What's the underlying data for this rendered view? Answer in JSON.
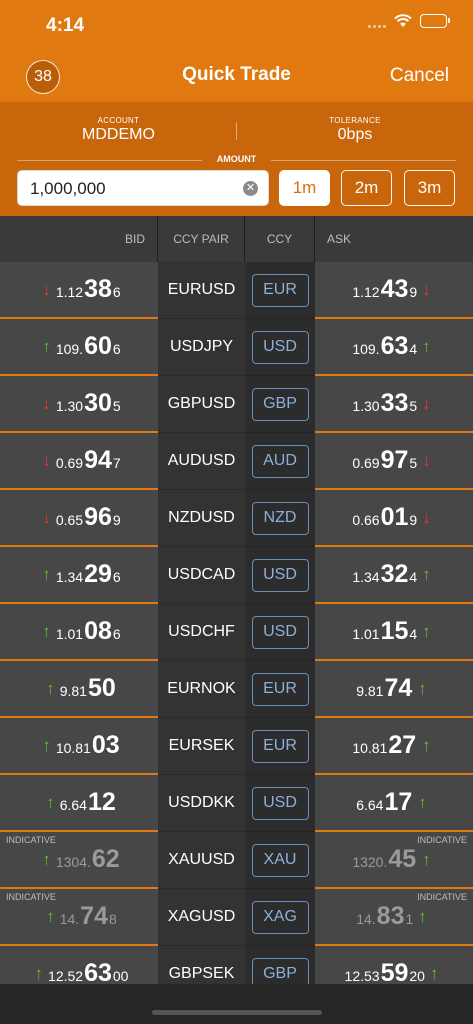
{
  "status": {
    "time": "4:14"
  },
  "nav": {
    "badge": "38",
    "title": "Quick Trade",
    "cancel": "Cancel"
  },
  "account": {
    "label": "ACCOUNT",
    "value": "MDDEMO"
  },
  "tolerance": {
    "label": "TOLERANCE",
    "value": "0bps"
  },
  "amount": {
    "label": "AMOUNT",
    "value": "1,000,000"
  },
  "quick_buttons": [
    {
      "label": "1m",
      "active": true
    },
    {
      "label": "2m",
      "active": false
    },
    {
      "label": "3m",
      "active": false
    }
  ],
  "table": {
    "headers": {
      "bid": "BID",
      "pair": "CCY PAIR",
      "ccy": "CCY",
      "ask": "ASK"
    },
    "rows": [
      {
        "pair": "EURUSD",
        "ccy": "EUR",
        "indicative": false,
        "bid": {
          "dir": "down",
          "small": "1.12",
          "big": "38",
          "pip": "6"
        },
        "ask": {
          "dir": "down",
          "small": "1.12",
          "big": "43",
          "pip": "9"
        }
      },
      {
        "pair": "USDJPY",
        "ccy": "USD",
        "indicative": false,
        "bid": {
          "dir": "up",
          "small": "109.",
          "big": "60",
          "pip": "6"
        },
        "ask": {
          "dir": "up",
          "small": "109.",
          "big": "63",
          "pip": "4"
        }
      },
      {
        "pair": "GBPUSD",
        "ccy": "GBP",
        "indicative": false,
        "bid": {
          "dir": "down",
          "small": "1.30",
          "big": "30",
          "pip": "5"
        },
        "ask": {
          "dir": "down",
          "small": "1.30",
          "big": "33",
          "pip": "5"
        }
      },
      {
        "pair": "AUDUSD",
        "ccy": "AUD",
        "indicative": false,
        "bid": {
          "dir": "down",
          "small": "0.69",
          "big": "94",
          "pip": "7"
        },
        "ask": {
          "dir": "down",
          "small": "0.69",
          "big": "97",
          "pip": "5"
        }
      },
      {
        "pair": "NZDUSD",
        "ccy": "NZD",
        "indicative": false,
        "bid": {
          "dir": "down",
          "small": "0.65",
          "big": "96",
          "pip": "9"
        },
        "ask": {
          "dir": "down",
          "small": "0.66",
          "big": "01",
          "pip": "9"
        }
      },
      {
        "pair": "USDCAD",
        "ccy": "USD",
        "indicative": false,
        "bid": {
          "dir": "up",
          "small": "1.34",
          "big": "29",
          "pip": "6"
        },
        "ask": {
          "dir": "up",
          "small": "1.34",
          "big": "32",
          "pip": "4"
        }
      },
      {
        "pair": "USDCHF",
        "ccy": "USD",
        "indicative": false,
        "bid": {
          "dir": "up",
          "small": "1.01",
          "big": "08",
          "pip": "6"
        },
        "ask": {
          "dir": "up",
          "small": "1.01",
          "big": "15",
          "pip": "4"
        }
      },
      {
        "pair": "EURNOK",
        "ccy": "EUR",
        "indicative": false,
        "bid": {
          "dir": "up",
          "small": "9.81",
          "big": "50",
          "pip": ""
        },
        "ask": {
          "dir": "up",
          "small": "9.81",
          "big": "74",
          "pip": ""
        }
      },
      {
        "pair": "EURSEK",
        "ccy": "EUR",
        "indicative": false,
        "bid": {
          "dir": "up",
          "small": "10.81",
          "big": "03",
          "pip": ""
        },
        "ask": {
          "dir": "up",
          "small": "10.81",
          "big": "27",
          "pip": ""
        }
      },
      {
        "pair": "USDDKK",
        "ccy": "USD",
        "indicative": false,
        "bid": {
          "dir": "up",
          "small": "6.64",
          "big": "12",
          "pip": ""
        },
        "ask": {
          "dir": "up",
          "small": "6.64",
          "big": "17",
          "pip": ""
        }
      },
      {
        "pair": "XAUUSD",
        "ccy": "XAU",
        "indicative": true,
        "label": "INDICATIVE",
        "bid": {
          "dir": "up",
          "small": "1304.",
          "big": "62",
          "pip": ""
        },
        "ask": {
          "dir": "up",
          "small": "1320.",
          "big": "45",
          "pip": ""
        }
      },
      {
        "pair": "XAGUSD",
        "ccy": "XAG",
        "indicative": true,
        "label": "INDICATIVE",
        "bid": {
          "dir": "up",
          "small": "14.",
          "big": "74",
          "pip": "8"
        },
        "ask": {
          "dir": "up",
          "small": "14.",
          "big": "83",
          "pip": "1"
        }
      },
      {
        "pair": "GBPSEK",
        "ccy": "GBP",
        "indicative": false,
        "bid": {
          "dir": "up",
          "small": "12.52",
          "big": "63",
          "pip": "00"
        },
        "ask": {
          "dir": "up",
          "small": "12.53",
          "big": "59",
          "pip": "20"
        }
      }
    ]
  },
  "colors": {
    "brand": "#e07a10",
    "up": "#5fbf2a",
    "down": "#e03a2a",
    "ccy_border": "#6e8fb5"
  },
  "icons": {
    "up": "arrow-up-icon",
    "down": "arrow-down-icon"
  }
}
